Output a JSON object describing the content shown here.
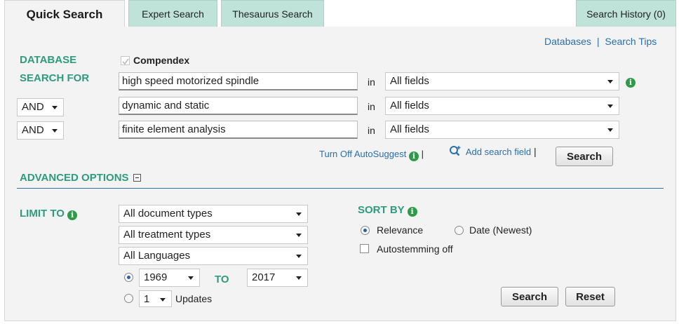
{
  "tabs": {
    "quick": "Quick Search",
    "expert": "Expert Search",
    "thesaurus": "Thesaurus Search",
    "history": "Search History (0)"
  },
  "top_links": {
    "databases": "Databases",
    "separator": "|",
    "search_tips": "Search Tips"
  },
  "database": {
    "label": "DATABASE",
    "name": "Compendex",
    "checked": true
  },
  "search_for": {
    "label": "SEARCH FOR",
    "in_label": "in",
    "rows": [
      {
        "operator": "",
        "term": "high speed motorized spindle",
        "field": "All fields"
      },
      {
        "operator": "AND",
        "term": "dynamic and static",
        "field": "All fields"
      },
      {
        "operator": "AND",
        "term": "finite element  analysis",
        "field": "All fields"
      }
    ]
  },
  "actions": {
    "autosuggest": "Turn Off AutoSuggest",
    "add_field": "Add search field",
    "search": "Search"
  },
  "advanced": {
    "label": "ADVANCED OPTIONS"
  },
  "limit": {
    "label": "LIMIT TO",
    "doc_types": "All document types",
    "treatment_types": "All treatment types",
    "languages": "All Languages",
    "year_from": "1969",
    "to_label": "TO",
    "year_to": "2017",
    "updates_value": "1",
    "updates_label": "Updates"
  },
  "sort": {
    "label": "SORT BY",
    "relevance": "Relevance",
    "date": "Date (Newest)",
    "autostemming": "Autostemming off"
  },
  "bottom_buttons": {
    "search": "Search",
    "reset": "Reset"
  },
  "colors": {
    "accent_green": "#2f9b7c",
    "tab_green": "#bfe3d8",
    "link_blue": "#2a6fa8",
    "info_green": "#2f9b4a"
  }
}
